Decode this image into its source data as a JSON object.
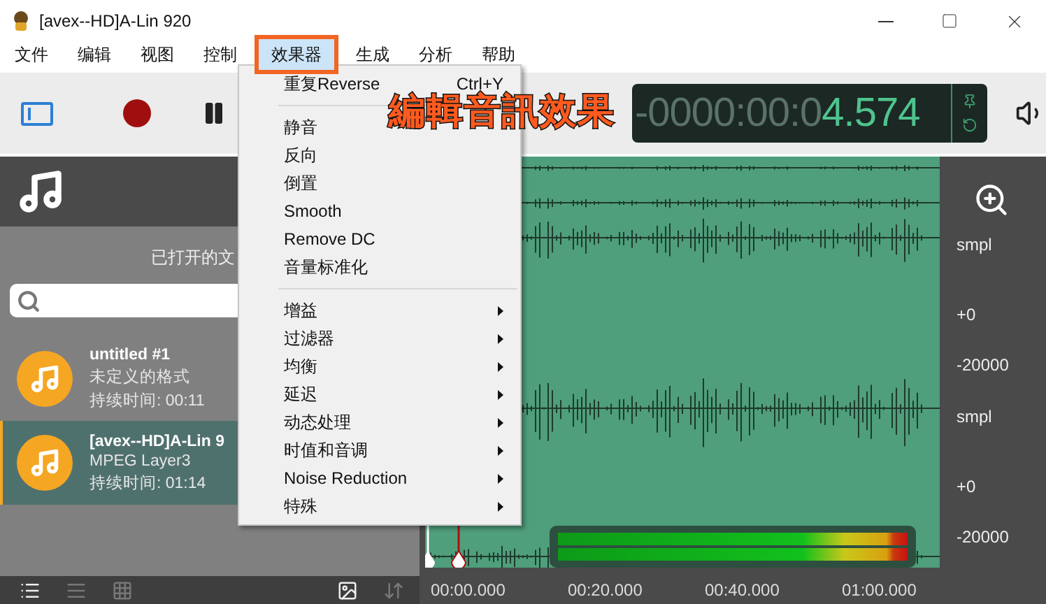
{
  "window": {
    "title": "[avex--HD]A-Lin 920"
  },
  "menu_bar": [
    {
      "label": "文件",
      "selected": false
    },
    {
      "label": "编辑",
      "selected": false
    },
    {
      "label": "视图",
      "selected": false
    },
    {
      "label": "控制",
      "selected": false
    },
    {
      "label": "效果器",
      "selected": true
    },
    {
      "label": "生成",
      "selected": false
    },
    {
      "label": "分析",
      "selected": false
    },
    {
      "label": "帮助",
      "selected": false
    }
  ],
  "effects_menu": [
    {
      "kind": "action",
      "label": "重复Reverse",
      "shortcut": "Ctrl+Y"
    },
    {
      "kind": "separator"
    },
    {
      "kind": "action",
      "label": "静音"
    },
    {
      "kind": "action",
      "label": "反向"
    },
    {
      "kind": "action",
      "label": "倒置"
    },
    {
      "kind": "action",
      "label": "Smooth"
    },
    {
      "kind": "action",
      "label": "Remove DC"
    },
    {
      "kind": "action",
      "label": "音量标准化"
    },
    {
      "kind": "separator"
    },
    {
      "kind": "submenu",
      "label": "增益"
    },
    {
      "kind": "submenu",
      "label": "过滤器"
    },
    {
      "kind": "submenu",
      "label": "均衡"
    },
    {
      "kind": "submenu",
      "label": "延迟"
    },
    {
      "kind": "submenu",
      "label": "动态处理"
    },
    {
      "kind": "submenu",
      "label": "时值和音调"
    },
    {
      "kind": "submenu",
      "label": "Noise Reduction"
    },
    {
      "kind": "submenu",
      "label": "特殊"
    }
  ],
  "caption": "編輯音訊效果",
  "timer": {
    "dim": "-0000:00:0",
    "value": "4.574"
  },
  "sidebar": {
    "title": "已打开的文",
    "files": [
      {
        "name": "untitled #1",
        "format": "未定义的格式",
        "duration": "持续时间: 00:11",
        "selected": false
      },
      {
        "name": "[avex--HD]A-Lin 9",
        "format": "MPEG Layer3",
        "duration": "持续时间: 01:14",
        "selected": true
      }
    ]
  },
  "ruler_labels": [
    "smpl",
    "+0",
    "-20000",
    "smpl",
    "+0",
    "-20000"
  ],
  "time_labels": [
    "00:00.000",
    "00:20.000",
    "00:40.000",
    "01:00.000"
  ],
  "level_meter": [
    {
      "level": 1
    },
    {
      "level": 1
    }
  ]
}
